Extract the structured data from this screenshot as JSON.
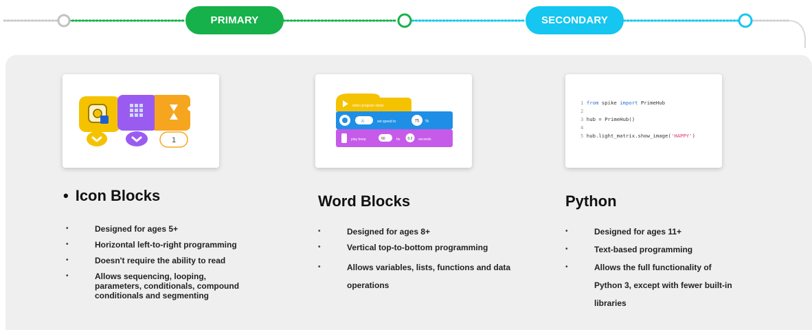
{
  "timeline": {
    "primary_label": "PRIMARY",
    "secondary_label": "SECONDARY"
  },
  "columns": [
    {
      "title": "Icon Blocks",
      "bullet": "•",
      "items": [
        "Designed for ages 5+",
        "Horizontal left-to-right programming",
        "Doesn't require the ability to read",
        "Allows sequencing, looping, parameters, conditionals, compound conditionals and segmenting"
      ],
      "image": {
        "value_label": "1"
      }
    },
    {
      "title": "Word Blocks",
      "items": [
        "Designed for ages 8+",
        "Vertical top-to-bottom programming",
        "Allows variables, lists, functions and data operations"
      ],
      "image": {
        "start_label": "when program starts",
        "motor_port": "A",
        "set_speed_label": "set speed to",
        "speed_value": "75",
        "unit": "%",
        "beep_label": "play beep",
        "beep_note": "60",
        "for_label": "for",
        "beep_duration": "0.2",
        "seconds_label": "seconds"
      }
    },
    {
      "title": "Python",
      "items": [
        "Designed for ages 11+",
        "Text-based programming",
        "Allows the full functionality of Python 3, except with fewer built-in libraries"
      ],
      "image": {
        "line1_num": "1",
        "line1_kw1": "from",
        "line1_mod": " spike ",
        "line1_kw2": "import",
        "line1_rest": " PrimeHub",
        "line2_num": "2",
        "line3_num": "3",
        "line3_code": " hub = PrimeHub()",
        "line4_num": "4",
        "line5_num": "5",
        "line5_code": " hub.light_matrix.show_image(",
        "line5_str": "'HAPPY'",
        "line5_end": ")"
      }
    }
  ],
  "colors": {
    "primary": "#16b14a",
    "secondary": "#14c6f0",
    "icon_yellow": "#f5c200",
    "icon_purple": "#9a5cf0",
    "icon_orange": "#f6a51e"
  }
}
